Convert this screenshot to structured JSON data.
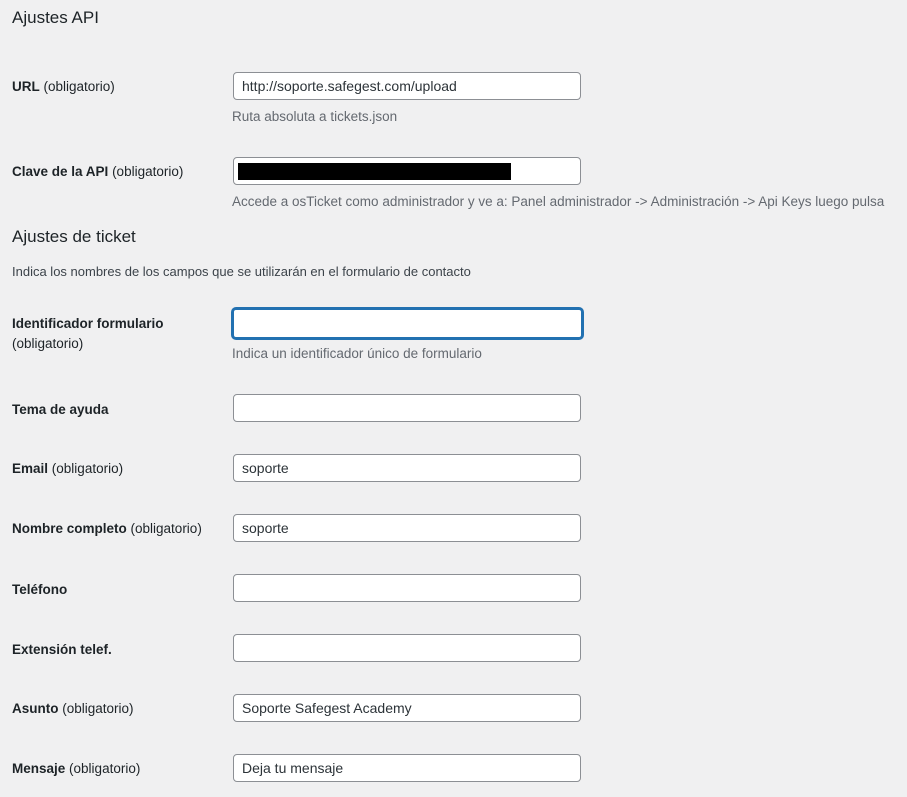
{
  "api_section": {
    "title": "Ajustes API",
    "url": {
      "label": "URL",
      "required": "(obligatorio)",
      "value": "http://soporte.safegest.com/upload",
      "description": "Ruta absoluta a tickets.json"
    },
    "api_key": {
      "label": "Clave de la API",
      "required": "(obligatorio)",
      "value": "",
      "redacted": true,
      "description": "Accede a osTicket como administrador y ve a: Panel administrador -> Administración -> Api Keys luego pulsa"
    }
  },
  "ticket_section": {
    "title": "Ajustes de ticket",
    "intro": "Indica los nombres de los campos que se utilizarán en el formulario de contacto",
    "fields": {
      "form_id": {
        "label": "Identificador formulario",
        "required": "(obligatorio)",
        "value": "",
        "description": "Indica un identificador único de formulario"
      },
      "help_topic": {
        "label": "Tema de ayuda",
        "value": ""
      },
      "email": {
        "label": "Email",
        "required": "(obligatorio)",
        "value": "soporte"
      },
      "full_name": {
        "label": "Nombre completo",
        "required": "(obligatorio)",
        "value": "soporte"
      },
      "phone": {
        "label": "Teléfono",
        "value": ""
      },
      "phone_ext": {
        "label": "Extensión telef.",
        "value": ""
      },
      "subject": {
        "label": "Asunto",
        "required": "(obligatorio)",
        "value": "Soporte Safegest Academy"
      },
      "message": {
        "label": "Mensaje",
        "required": "(obligatorio)",
        "value": "Deja tu mensaje"
      }
    }
  },
  "colors": {
    "background": "#f0f0f1",
    "focus_border": "#2271b1",
    "description_text": "#646970",
    "field_border": "#8c8f94"
  }
}
